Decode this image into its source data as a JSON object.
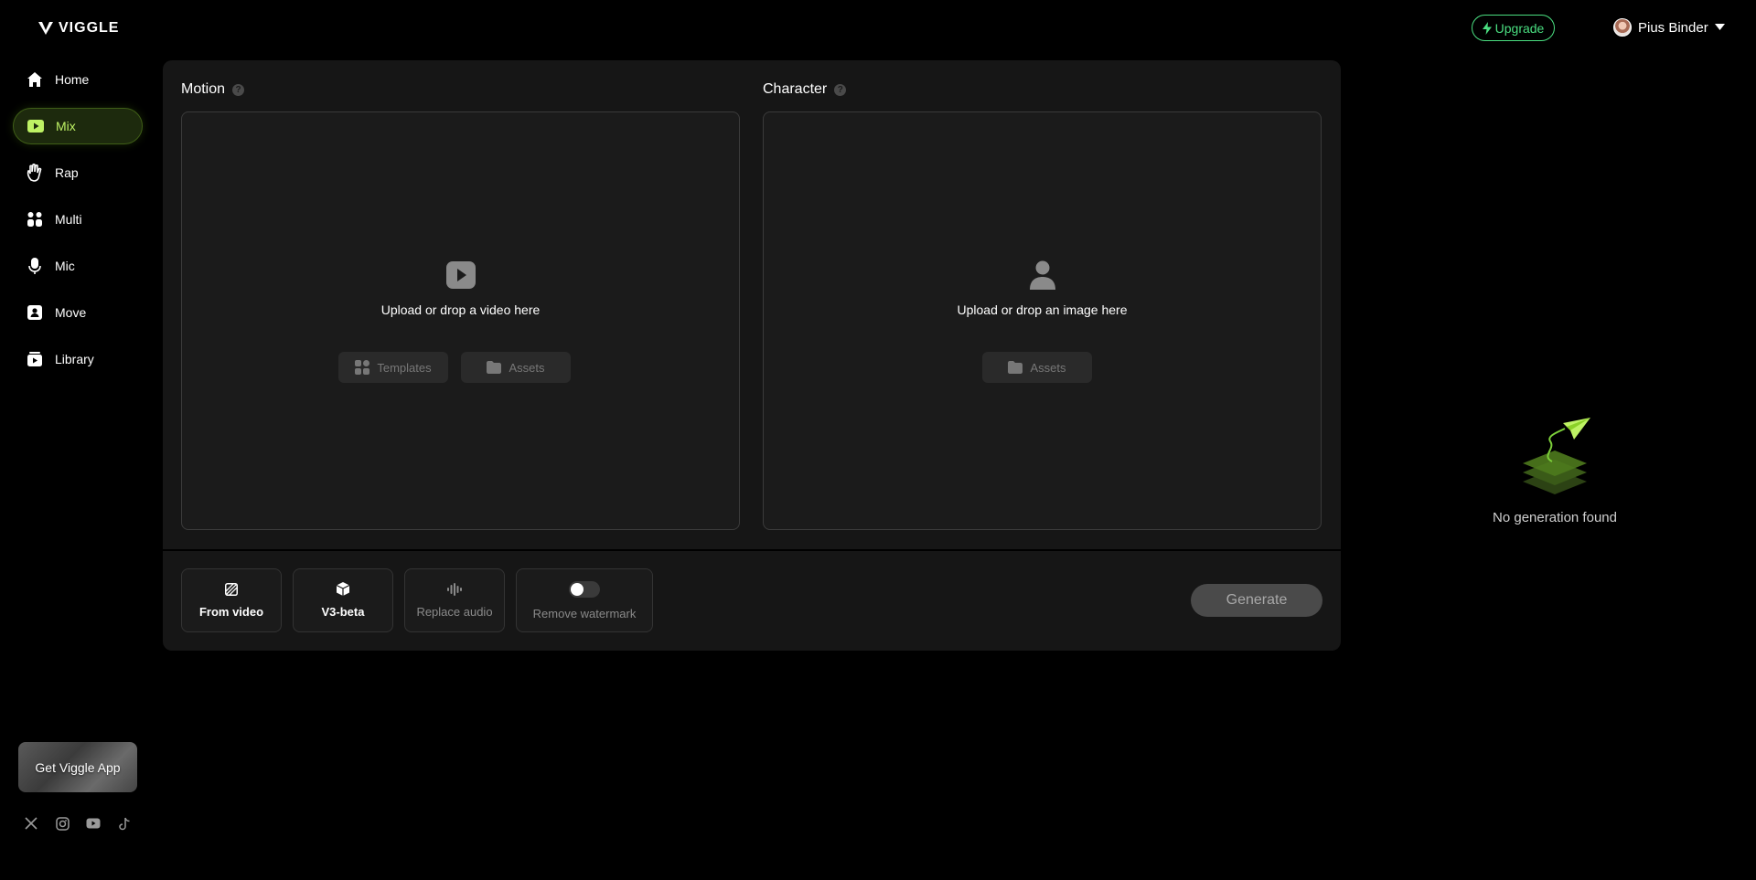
{
  "brand": {
    "name": "VIGGLE"
  },
  "sidebar": {
    "items": [
      {
        "label": "Home",
        "icon": "home-icon"
      },
      {
        "label": "Mix",
        "icon": "mix-icon",
        "active": true
      },
      {
        "label": "Rap",
        "icon": "rap-hand-icon"
      },
      {
        "label": "Multi",
        "icon": "multi-icon"
      },
      {
        "label": "Mic",
        "icon": "mic-icon"
      },
      {
        "label": "Move",
        "icon": "move-icon"
      },
      {
        "label": "Library",
        "icon": "library-icon"
      }
    ],
    "get_app_label": "Get Viggle App",
    "socials": [
      "x-icon",
      "instagram-icon",
      "youtube-icon",
      "tiktok-icon"
    ]
  },
  "header": {
    "upgrade_label": "Upgrade",
    "user_name": "Pius Binder"
  },
  "motion": {
    "title": "Motion",
    "upload_text": "Upload or drop a video here",
    "templates_label": "Templates",
    "assets_label": "Assets"
  },
  "character": {
    "title": "Character",
    "upload_text": "Upload or drop an image here",
    "assets_label": "Assets"
  },
  "options": {
    "from_video_label": "From video",
    "model_label": "V3-beta",
    "replace_audio_label": "Replace audio",
    "remove_watermark_label": "Remove watermark",
    "remove_watermark_on": false
  },
  "generate_label": "Generate",
  "empty_state": {
    "text": "No generation found"
  },
  "colors": {
    "accent": "#bef264",
    "upgrade": "#4ade80",
    "card": "#161616"
  }
}
